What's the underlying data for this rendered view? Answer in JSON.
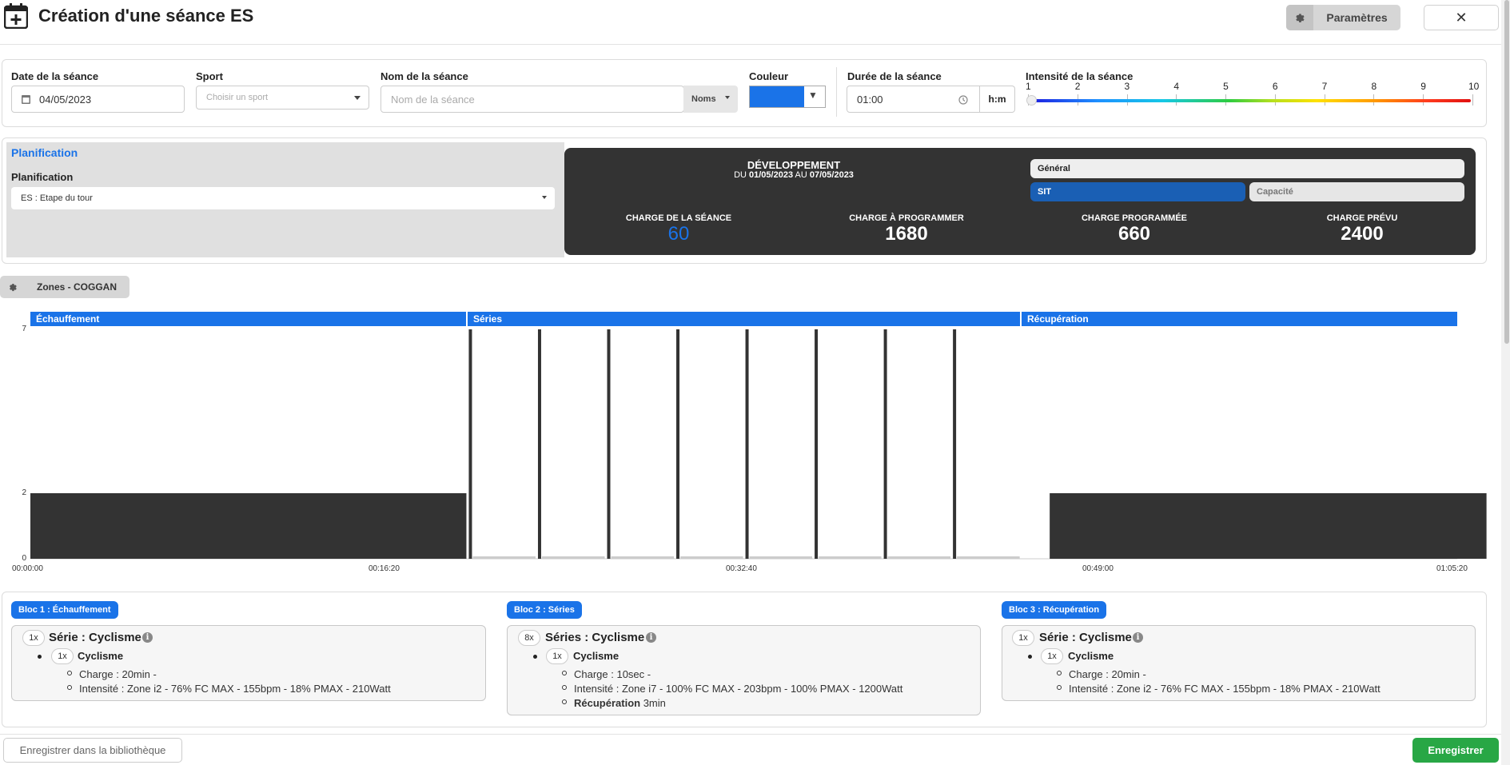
{
  "header": {
    "title": "Création d'une séance ES",
    "params_label": "Paramètres",
    "close_label": "✕"
  },
  "form": {
    "date_label": "Date de la séance",
    "date_value": "04/05/2023",
    "sport_label": "Sport",
    "sport_placeholder": "Choisir un sport",
    "name_label": "Nom de la séance",
    "name_placeholder": "Nom de la séance",
    "names_dropdown": "Noms",
    "color_label": "Couleur",
    "color_value": "#1a73e8",
    "duration_label": "Durée de la séance",
    "duration_value": "01:00",
    "duration_unit": "h:m",
    "intensity_label": "Intensité de la séance",
    "intensity_ticks": [
      "1",
      "2",
      "3",
      "4",
      "5",
      "6",
      "7",
      "8",
      "9",
      "10"
    ],
    "intensity_value": 1
  },
  "planification": {
    "section_title": "Planification",
    "field_label": "Planification",
    "selected": "ES : Etape du tour",
    "period_title": "DÉVELOPPEMENT",
    "period_du": "DU",
    "period_start": "01/05/2023",
    "period_au": "AU",
    "period_end": "07/05/2023",
    "kpis": [
      {
        "label": "CHARGE DE LA SÉANCE",
        "value": "60"
      },
      {
        "label": "CHARGE À PROGRAMMER",
        "value": "1680"
      },
      {
        "label": "CHARGE PROGRAMMÉE",
        "value": "660"
      },
      {
        "label": "CHARGE PRÉVU",
        "value": "2400"
      }
    ],
    "pill_general": "Général",
    "pill_sit": "SIT",
    "pill_capacite": "Capacité"
  },
  "zones": {
    "label": "Zones - COGGAN"
  },
  "chart_data": {
    "type": "bar",
    "phases": [
      "Échauffement",
      "Séries",
      "Récupération"
    ],
    "yticks": [
      "7",
      "2",
      "0"
    ],
    "ylim": [
      0,
      7
    ],
    "xticks": [
      "00:00:00",
      "00:16:20",
      "00:32:40",
      "00:49:00",
      "01:05:20"
    ],
    "segments": [
      {
        "phase": "Échauffement",
        "start_min": 0,
        "duration_min": 20,
        "zone": 2
      },
      {
        "phase": "Séries",
        "repetitions": 8,
        "effort_sec": 10,
        "effort_zone": 7,
        "recovery_min": 3
      },
      {
        "phase": "Récupération",
        "start_min": 46.67,
        "duration_min": 20,
        "zone": 2
      }
    ],
    "total_min": 65.33
  },
  "blocs": [
    {
      "badge": "Bloc 1 : Échauffement",
      "rep": "1x",
      "title": "Série : Cyclisme",
      "sub_rep": "1x",
      "sub_title": "Cyclisme",
      "charge": "Charge : 20min -",
      "intensity": "Intensité : Zone i2 - 76% FC MAX - 155bpm - 18% PMAX - 210Watt"
    },
    {
      "badge": "Bloc 2 : Séries",
      "rep": "8x",
      "title": "Séries : Cyclisme",
      "sub_rep": "1x",
      "sub_title": "Cyclisme",
      "charge": "Charge : 10sec -",
      "intensity": "Intensité : Zone i7 - 100% FC MAX - 203bpm - 100% PMAX - 1200Watt",
      "recovery_label": "Récupération",
      "recovery_value": "3min"
    },
    {
      "badge": "Bloc 3 : Récupération",
      "rep": "1x",
      "title": "Série : Cyclisme",
      "sub_rep": "1x",
      "sub_title": "Cyclisme",
      "charge": "Charge : 20min -",
      "intensity": "Intensité : Zone i2 - 76% FC MAX - 155bpm - 18% PMAX - 210Watt"
    }
  ],
  "footer": {
    "library_label": "Enregistrer dans la bibliothèque",
    "save_label": "Enregistrer"
  },
  "icons": [
    "calendar-plus-icon",
    "gear-icon",
    "close-icon",
    "calendar-icon",
    "clock-icon",
    "chevron-down-icon",
    "info-icon"
  ]
}
